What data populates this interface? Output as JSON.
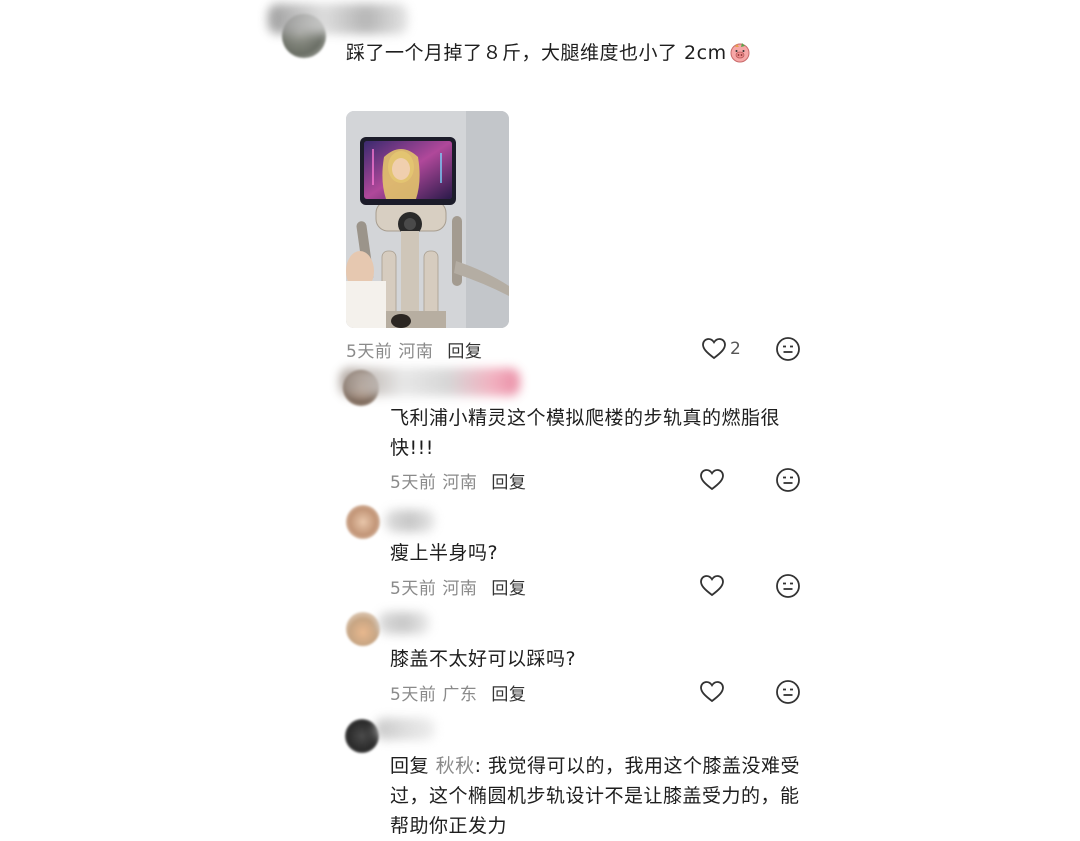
{
  "post": {
    "text": "踩了一个月掉了８斤，大腿维度也小了 2cm",
    "emoji_icon": "pig-face-emoji",
    "meta_time": "5天前",
    "meta_location": "河南",
    "reply_label": "回复",
    "like_count": "2"
  },
  "comments": [
    {
      "text": "飞利浦小精灵这个模拟爬楼的步轨真的燃脂很快!!!",
      "line1": "飞利浦小精灵这个模拟爬楼的步轨真的燃脂很",
      "line2": "快!!!",
      "meta_time": "5天前",
      "meta_location": "河南",
      "reply_label": "回复"
    },
    {
      "text": "瘦上半身吗?",
      "meta_time": "5天前",
      "meta_location": "河南",
      "reply_label": "回复"
    },
    {
      "text": "膝盖不太好可以踩吗?",
      "meta_time": "5天前",
      "meta_location": "广东",
      "reply_label": "回复"
    },
    {
      "reply_prefix": "回复",
      "reply_to": "秋秋",
      "line1_rest": ": 我觉得可以的，我用这个膝盖没难受",
      "line2": "过，这个椭圆机步轨设计不是让膝盖受力的，能",
      "line3": "帮助你正发力"
    }
  ],
  "colors": {
    "like_heart": "#333333",
    "meta_text": "#8a8a8a"
  }
}
